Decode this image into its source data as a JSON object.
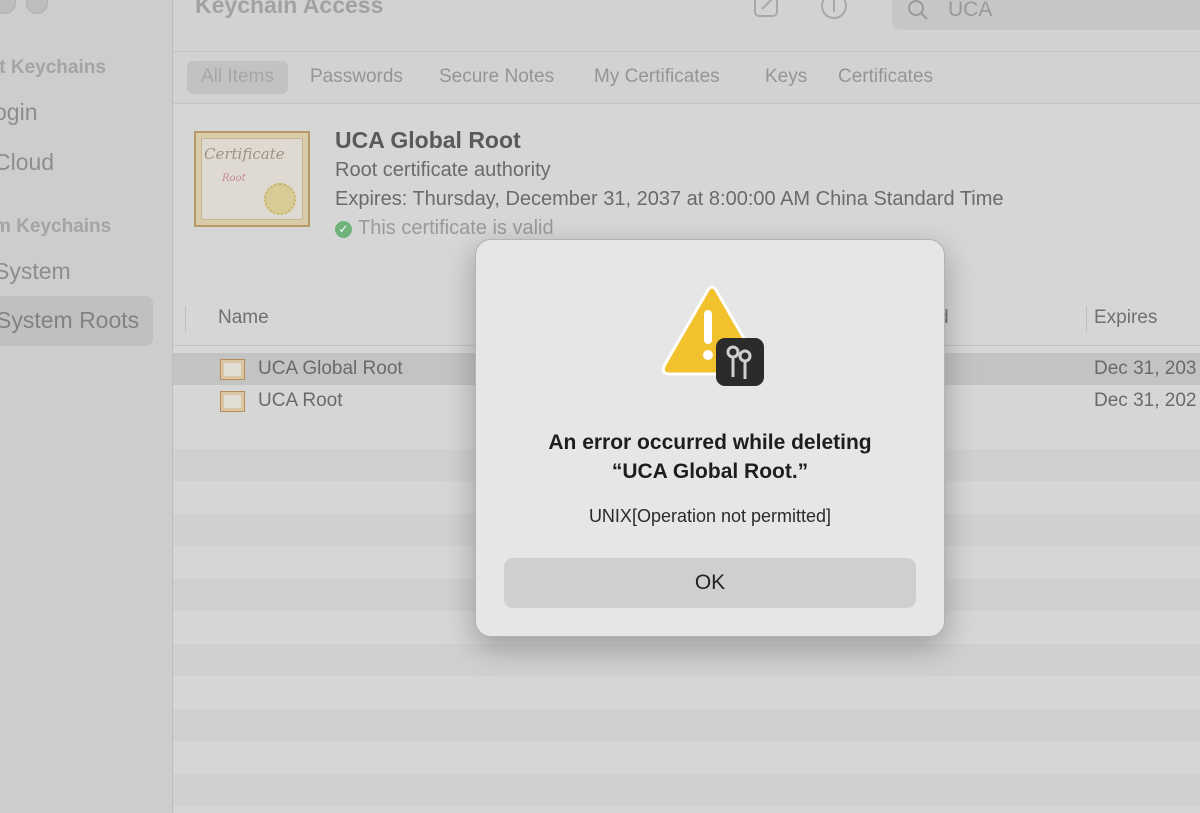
{
  "app": {
    "title": "Keychain Access",
    "search_query": "UCA"
  },
  "sidebar": {
    "default_keychains_label": "lt Keychains",
    "system_keychains_label": "m Keychains",
    "items": [
      {
        "label": "ogin"
      },
      {
        "label": "Cloud"
      },
      {
        "label": "System"
      },
      {
        "label": "System Roots",
        "selected": true
      }
    ]
  },
  "tabs": [
    {
      "label": "All Items",
      "active": true
    },
    {
      "label": "Passwords"
    },
    {
      "label": "Secure Notes"
    },
    {
      "label": "My Certificates"
    },
    {
      "label": "Keys"
    },
    {
      "label": "Certificates"
    }
  ],
  "detail": {
    "icon_text": "Certificate",
    "icon_subtext": "Root",
    "title": "UCA Global Root",
    "subtitle": "Root certificate authority",
    "expires": "Expires: Thursday, December 31, 2037 at 8:00:00 AM China Standard Time",
    "validity": "This certificate is valid",
    "validity_color": "#6fb27c"
  },
  "table": {
    "columns": [
      "Name",
      "d",
      "Expires"
    ],
    "rows": [
      {
        "name": "UCA Global Root",
        "expires": "Dec 31, 203",
        "selected": true
      },
      {
        "name": "UCA Root",
        "expires": "Dec 31, 202"
      }
    ]
  },
  "alert": {
    "icon": "warning-keychain-icon",
    "title_line1": "An error occurred while deleting",
    "title_line2": "“UCA Global Root.”",
    "message": "UNIX[Operation not permitted]",
    "ok_label": "OK",
    "warning_color": "#f2c12e"
  }
}
